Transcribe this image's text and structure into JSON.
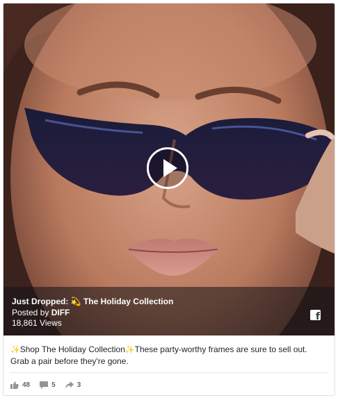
{
  "video": {
    "title_prefix": "Just Dropped: ",
    "title_emoji": "💫",
    "title_suffix": " The Holiday Collection",
    "posted_prefix": "Posted by ",
    "page_name": "DIFF",
    "views": "18,861 Views",
    "platform_logo": "f"
  },
  "caption": {
    "sparkle_left": "✨",
    "link_text": "Shop The Holiday Collection",
    "sparkle_right": "✨",
    "body": "These party-worthy frames are sure to sell out. Grab a pair before they're gone."
  },
  "stats": {
    "likes": "48",
    "comments": "5",
    "shares": "3"
  },
  "icons": {
    "play": "play-icon",
    "platform": "facebook-icon",
    "like": "thumbs-up-icon",
    "comment": "comment-icon",
    "share": "share-icon"
  },
  "colors": {
    "overlay": "#141418",
    "text": "#1d2129",
    "muted": "#606770",
    "sparkle": "#f2c12e"
  }
}
